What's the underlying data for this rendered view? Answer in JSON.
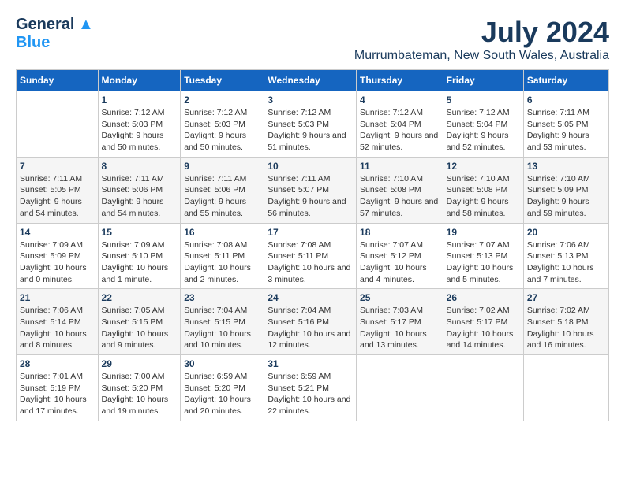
{
  "logo": {
    "line1": "General",
    "line2": "Blue"
  },
  "title": "July 2024",
  "location": "Murrumbateman, New South Wales, Australia",
  "days_of_week": [
    "Sunday",
    "Monday",
    "Tuesday",
    "Wednesday",
    "Thursday",
    "Friday",
    "Saturday"
  ],
  "weeks": [
    [
      {
        "day": "",
        "sunrise": "",
        "sunset": "",
        "daylight": ""
      },
      {
        "day": "1",
        "sunrise": "Sunrise: 7:12 AM",
        "sunset": "Sunset: 5:03 PM",
        "daylight": "Daylight: 9 hours and 50 minutes."
      },
      {
        "day": "2",
        "sunrise": "Sunrise: 7:12 AM",
        "sunset": "Sunset: 5:03 PM",
        "daylight": "Daylight: 9 hours and 50 minutes."
      },
      {
        "day": "3",
        "sunrise": "Sunrise: 7:12 AM",
        "sunset": "Sunset: 5:03 PM",
        "daylight": "Daylight: 9 hours and 51 minutes."
      },
      {
        "day": "4",
        "sunrise": "Sunrise: 7:12 AM",
        "sunset": "Sunset: 5:04 PM",
        "daylight": "Daylight: 9 hours and 52 minutes."
      },
      {
        "day": "5",
        "sunrise": "Sunrise: 7:12 AM",
        "sunset": "Sunset: 5:04 PM",
        "daylight": "Daylight: 9 hours and 52 minutes."
      },
      {
        "day": "6",
        "sunrise": "Sunrise: 7:11 AM",
        "sunset": "Sunset: 5:05 PM",
        "daylight": "Daylight: 9 hours and 53 minutes."
      }
    ],
    [
      {
        "day": "7",
        "sunrise": "Sunrise: 7:11 AM",
        "sunset": "Sunset: 5:05 PM",
        "daylight": "Daylight: 9 hours and 54 minutes."
      },
      {
        "day": "8",
        "sunrise": "Sunrise: 7:11 AM",
        "sunset": "Sunset: 5:06 PM",
        "daylight": "Daylight: 9 hours and 54 minutes."
      },
      {
        "day": "9",
        "sunrise": "Sunrise: 7:11 AM",
        "sunset": "Sunset: 5:06 PM",
        "daylight": "Daylight: 9 hours and 55 minutes."
      },
      {
        "day": "10",
        "sunrise": "Sunrise: 7:11 AM",
        "sunset": "Sunset: 5:07 PM",
        "daylight": "Daylight: 9 hours and 56 minutes."
      },
      {
        "day": "11",
        "sunrise": "Sunrise: 7:10 AM",
        "sunset": "Sunset: 5:08 PM",
        "daylight": "Daylight: 9 hours and 57 minutes."
      },
      {
        "day": "12",
        "sunrise": "Sunrise: 7:10 AM",
        "sunset": "Sunset: 5:08 PM",
        "daylight": "Daylight: 9 hours and 58 minutes."
      },
      {
        "day": "13",
        "sunrise": "Sunrise: 7:10 AM",
        "sunset": "Sunset: 5:09 PM",
        "daylight": "Daylight: 9 hours and 59 minutes."
      }
    ],
    [
      {
        "day": "14",
        "sunrise": "Sunrise: 7:09 AM",
        "sunset": "Sunset: 5:09 PM",
        "daylight": "Daylight: 10 hours and 0 minutes."
      },
      {
        "day": "15",
        "sunrise": "Sunrise: 7:09 AM",
        "sunset": "Sunset: 5:10 PM",
        "daylight": "Daylight: 10 hours and 1 minute."
      },
      {
        "day": "16",
        "sunrise": "Sunrise: 7:08 AM",
        "sunset": "Sunset: 5:11 PM",
        "daylight": "Daylight: 10 hours and 2 minutes."
      },
      {
        "day": "17",
        "sunrise": "Sunrise: 7:08 AM",
        "sunset": "Sunset: 5:11 PM",
        "daylight": "Daylight: 10 hours and 3 minutes."
      },
      {
        "day": "18",
        "sunrise": "Sunrise: 7:07 AM",
        "sunset": "Sunset: 5:12 PM",
        "daylight": "Daylight: 10 hours and 4 minutes."
      },
      {
        "day": "19",
        "sunrise": "Sunrise: 7:07 AM",
        "sunset": "Sunset: 5:13 PM",
        "daylight": "Daylight: 10 hours and 5 minutes."
      },
      {
        "day": "20",
        "sunrise": "Sunrise: 7:06 AM",
        "sunset": "Sunset: 5:13 PM",
        "daylight": "Daylight: 10 hours and 7 minutes."
      }
    ],
    [
      {
        "day": "21",
        "sunrise": "Sunrise: 7:06 AM",
        "sunset": "Sunset: 5:14 PM",
        "daylight": "Daylight: 10 hours and 8 minutes."
      },
      {
        "day": "22",
        "sunrise": "Sunrise: 7:05 AM",
        "sunset": "Sunset: 5:15 PM",
        "daylight": "Daylight: 10 hours and 9 minutes."
      },
      {
        "day": "23",
        "sunrise": "Sunrise: 7:04 AM",
        "sunset": "Sunset: 5:15 PM",
        "daylight": "Daylight: 10 hours and 10 minutes."
      },
      {
        "day": "24",
        "sunrise": "Sunrise: 7:04 AM",
        "sunset": "Sunset: 5:16 PM",
        "daylight": "Daylight: 10 hours and 12 minutes."
      },
      {
        "day": "25",
        "sunrise": "Sunrise: 7:03 AM",
        "sunset": "Sunset: 5:17 PM",
        "daylight": "Daylight: 10 hours and 13 minutes."
      },
      {
        "day": "26",
        "sunrise": "Sunrise: 7:02 AM",
        "sunset": "Sunset: 5:17 PM",
        "daylight": "Daylight: 10 hours and 14 minutes."
      },
      {
        "day": "27",
        "sunrise": "Sunrise: 7:02 AM",
        "sunset": "Sunset: 5:18 PM",
        "daylight": "Daylight: 10 hours and 16 minutes."
      }
    ],
    [
      {
        "day": "28",
        "sunrise": "Sunrise: 7:01 AM",
        "sunset": "Sunset: 5:19 PM",
        "daylight": "Daylight: 10 hours and 17 minutes."
      },
      {
        "day": "29",
        "sunrise": "Sunrise: 7:00 AM",
        "sunset": "Sunset: 5:20 PM",
        "daylight": "Daylight: 10 hours and 19 minutes."
      },
      {
        "day": "30",
        "sunrise": "Sunrise: 6:59 AM",
        "sunset": "Sunset: 5:20 PM",
        "daylight": "Daylight: 10 hours and 20 minutes."
      },
      {
        "day": "31",
        "sunrise": "Sunrise: 6:59 AM",
        "sunset": "Sunset: 5:21 PM",
        "daylight": "Daylight: 10 hours and 22 minutes."
      },
      {
        "day": "",
        "sunrise": "",
        "sunset": "",
        "daylight": ""
      },
      {
        "day": "",
        "sunrise": "",
        "sunset": "",
        "daylight": ""
      },
      {
        "day": "",
        "sunrise": "",
        "sunset": "",
        "daylight": ""
      }
    ]
  ]
}
